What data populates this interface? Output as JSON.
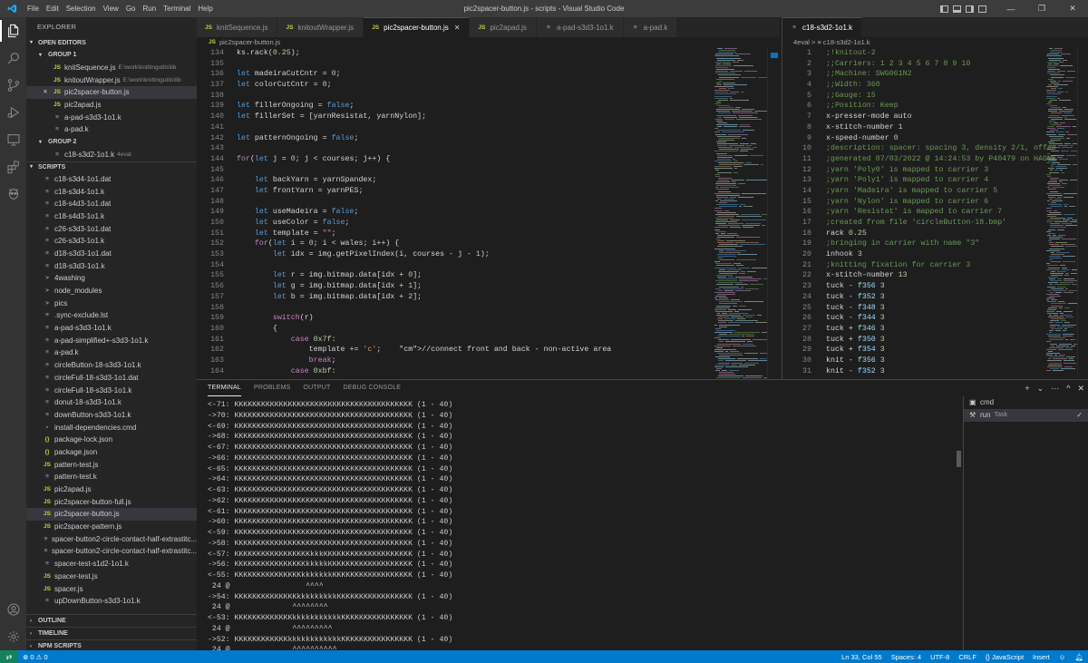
{
  "window": {
    "title": "pic2spacer-button.js - scripts - Visual Studio Code",
    "menu": [
      "File",
      "Edit",
      "Selection",
      "View",
      "Go",
      "Run",
      "Terminal",
      "Help"
    ],
    "controls": [
      "minimize",
      "restore",
      "close"
    ]
  },
  "activity_bar": {
    "icons": [
      "files-icon",
      "search-icon",
      "source-control-icon",
      "run-debug-icon",
      "remote-explorer-icon",
      "extensions-icon",
      "alien-icon"
    ],
    "bottom_icons": [
      "account-icon",
      "settings-gear-icon"
    ]
  },
  "sidebar": {
    "title": "EXPLORER",
    "open_editors_label": "OPEN EDITORS",
    "group1_label": "GROUP 1",
    "group1": [
      {
        "name": "knitSequence.js",
        "desc": "E:\\work\\knittingutils\\lib",
        "icon": "JS"
      },
      {
        "name": "knitoutWrapper.js",
        "desc": "E:\\work\\knittingutils\\lib",
        "icon": "JS"
      },
      {
        "name": "pic2spacer-button.js",
        "desc": "",
        "icon": "JS",
        "close": "✕"
      },
      {
        "name": "pic2apad.js",
        "desc": "",
        "icon": "JS"
      },
      {
        "name": "a-pad-s3d3-1o1.k",
        "desc": "",
        "icon": "≡"
      },
      {
        "name": "a-pad.k",
        "desc": "",
        "icon": "≡"
      }
    ],
    "group2_label": "GROUP 2",
    "group2": [
      {
        "name": "c18-s3d2-1o1.k",
        "desc": "4eval",
        "icon": "≡"
      }
    ],
    "scripts_label": "SCRIPTS",
    "scripts": [
      {
        "name": "c18-s3d4-1o1.dat",
        "icon": "≡"
      },
      {
        "name": "c18-s3d4-1o1.k",
        "icon": "≡"
      },
      {
        "name": "c18-s4d3-1o1.dat",
        "icon": "≡"
      },
      {
        "name": "c18-s4d3-1o1.k",
        "icon": "≡"
      },
      {
        "name": "c26-s3d3-1o1.dat",
        "icon": "≡"
      },
      {
        "name": "c26-s3d3-1o1.k",
        "icon": "≡"
      },
      {
        "name": "d18-s3d3-1o1.dat",
        "icon": "≡"
      },
      {
        "name": "d18-s3d3-1o1.k",
        "icon": "≡"
      },
      {
        "name": "4washing",
        "icon": ">"
      },
      {
        "name": "node_modules",
        "icon": ">"
      },
      {
        "name": "pics",
        "icon": ">"
      },
      {
        "name": ".sync-exclude.lst",
        "icon": "≡"
      },
      {
        "name": "a-pad-s3d3-1o1.k",
        "icon": "≡"
      },
      {
        "name": "a-pad-simplified+-s3d3-1o1.k",
        "icon": "≡"
      },
      {
        "name": "a-pad.k",
        "icon": "≡"
      },
      {
        "name": "circleButton-18-s3d3-1o1.k",
        "icon": "≡"
      },
      {
        "name": "circleFull-18-s3d3-1o1.dat",
        "icon": "≡"
      },
      {
        "name": "circleFull-18-s3d3-1o1.k",
        "icon": "≡"
      },
      {
        "name": "donut-18-s3d3-1o1.k",
        "icon": "≡"
      },
      {
        "name": "downButton-s3d3-1o1.k",
        "icon": "≡"
      },
      {
        "name": "install-dependencies.cmd",
        "icon": "▪"
      },
      {
        "name": "package-lock.json",
        "icon": "{}"
      },
      {
        "name": "package.json",
        "icon": "{}"
      },
      {
        "name": "pattern-test.js",
        "icon": "JS"
      },
      {
        "name": "pattern-test.k",
        "icon": "≡"
      },
      {
        "name": "pic2apad.js",
        "icon": "JS"
      },
      {
        "name": "pic2spacer-button-full.js",
        "icon": "JS"
      },
      {
        "name": "pic2spacer-button.js",
        "icon": "JS"
      },
      {
        "name": "pic2spacer-pattern.js",
        "icon": "JS"
      },
      {
        "name": "spacer-button2-circle-contact-half-extrastitc...",
        "icon": "≡"
      },
      {
        "name": "spacer-button2-circle-contact-half-extrastitc...",
        "icon": "≡"
      },
      {
        "name": "spacer-test-s1d2-1o1.k",
        "icon": "≡"
      },
      {
        "name": "spacer-test.js",
        "icon": "JS"
      },
      {
        "name": "spacer.js",
        "icon": "JS"
      },
      {
        "name": "upDownButton-s3d3-1o1.k",
        "icon": "≡"
      }
    ],
    "outline_label": "OUTLINE",
    "timeline_label": "TIMELINE",
    "npm_label": "NPM SCRIPTS"
  },
  "editor1": {
    "tabs": [
      {
        "label": "knitSequence.js",
        "icon": "JS"
      },
      {
        "label": "knitoutWrapper.js",
        "icon": "JS"
      },
      {
        "label": "pic2spacer-button.js",
        "icon": "JS",
        "close": "✕"
      },
      {
        "label": "pic2apad.js",
        "icon": "JS"
      },
      {
        "label": "a-pad-s3d3-1o1.k",
        "icon": "≡"
      },
      {
        "label": "a-pad.k",
        "icon": "≡"
      }
    ],
    "breadcrumb": "pic2spacer-button.js",
    "lines": [
      {
        "n": "134",
        "t": "ks.rack(0.25);"
      },
      {
        "n": "135",
        "t": ""
      },
      {
        "n": "136",
        "t": "let madeiraCutCntr = 0;"
      },
      {
        "n": "137",
        "t": "let colorCutCntr = 0;"
      },
      {
        "n": "138",
        "t": ""
      },
      {
        "n": "139",
        "t": "let fillerOngoing = false;"
      },
      {
        "n": "140",
        "t": "let fillerSet = [yarnResistat, yarnNylon];"
      },
      {
        "n": "141",
        "t": ""
      },
      {
        "n": "142",
        "t": "let patternOngoing = false;"
      },
      {
        "n": "143",
        "t": ""
      },
      {
        "n": "144",
        "t": "for(let j = 0; j < courses; j++) {"
      },
      {
        "n": "145",
        "t": ""
      },
      {
        "n": "146",
        "t": "    let backYarn = yarnSpandex;"
      },
      {
        "n": "147",
        "t": "    let frontYarn = yarnPES;"
      },
      {
        "n": "148",
        "t": ""
      },
      {
        "n": "149",
        "t": "    let useMadeira = false;"
      },
      {
        "n": "150",
        "t": "    let useColor = false;"
      },
      {
        "n": "151",
        "t": "    let template = \"\";"
      },
      {
        "n": "152",
        "t": "    for(let i = 0; i < wales; i++) {"
      },
      {
        "n": "153",
        "t": "        let idx = img.getPixelIndex(i, courses - j - 1);"
      },
      {
        "n": "154",
        "t": ""
      },
      {
        "n": "155",
        "t": "        let r = img.bitmap.data[idx + 0];"
      },
      {
        "n": "156",
        "t": "        let g = img.bitmap.data[idx + 1];"
      },
      {
        "n": "157",
        "t": "        let b = img.bitmap.data[idx + 2];"
      },
      {
        "n": "158",
        "t": ""
      },
      {
        "n": "159",
        "t": "        switch(r)"
      },
      {
        "n": "160",
        "t": "        {"
      },
      {
        "n": "161",
        "t": "            case 0x7f:"
      },
      {
        "n": "162",
        "t": "                template += 'c';    //connect front and back - non-active area"
      },
      {
        "n": "163",
        "t": "                break;"
      },
      {
        "n": "164",
        "t": "            case 0xbf:"
      }
    ]
  },
  "editor2": {
    "tabs": [
      {
        "label": "c18-s3d2-1o1.k",
        "icon": "≡"
      }
    ],
    "breadcrumb": "4eval  >  ≡  c18-s3d2-1o1.k",
    "lines": [
      {
        "n": "1",
        "t": ";!knitout-2",
        "c": "cm"
      },
      {
        "n": "2",
        "t": ";;Carriers: 1 2 3 4 5 6 7 8 9 10",
        "c": "cm"
      },
      {
        "n": "3",
        "t": ";;Machine: SWG061N2",
        "c": "cm"
      },
      {
        "n": "4",
        "t": ";;Width: 360",
        "c": "cm"
      },
      {
        "n": "5",
        "t": ";;Gauge: 15",
        "c": "cm"
      },
      {
        "n": "6",
        "t": ";;Position: Keep",
        "c": "cm"
      },
      {
        "n": "7",
        "t": "x-presser-mode auto",
        "c": ""
      },
      {
        "n": "8",
        "t": "x-stitch-number 1",
        "c": ""
      },
      {
        "n": "9",
        "t": "x-speed-number 0",
        "c": ""
      },
      {
        "n": "10",
        "t": ";description: spacer: spacing 3, density 2/1, offes",
        "c": "cm"
      },
      {
        "n": "11",
        "t": ";generated 07/03/2022 @ 14:24:53 by P40479 on HAGNE",
        "c": "cm"
      },
      {
        "n": "12",
        "t": ";yarn 'Poly0' is mapped to carrier 3",
        "c": "cm"
      },
      {
        "n": "13",
        "t": ";yarn 'Poly1' is mapped to carrier 4",
        "c": "cm"
      },
      {
        "n": "14",
        "t": ";yarn 'Madeira' is mapped to carrier 5",
        "c": "cm"
      },
      {
        "n": "15",
        "t": ";yarn 'Nylon' is mapped to carrier 6",
        "c": "cm"
      },
      {
        "n": "16",
        "t": ";yarn 'Resistat' is mapped to carrier 7",
        "c": "cm"
      },
      {
        "n": "17",
        "t": ";created from file 'circleButton-18.bmp'",
        "c": "cm"
      },
      {
        "n": "18",
        "t": "rack 0.25",
        "c": ""
      },
      {
        "n": "19",
        "t": ";bringing in carrier with name \"3\"",
        "c": "cm"
      },
      {
        "n": "20",
        "t": "inhook 3",
        "c": ""
      },
      {
        "n": "21",
        "t": ";knitting fixation for carrier 3",
        "c": "cm"
      },
      {
        "n": "22",
        "t": "x-stitch-number 13",
        "c": ""
      },
      {
        "n": "23",
        "t": "tuck - f356 3",
        "c": ""
      },
      {
        "n": "24",
        "t": "tuck - f352 3",
        "c": ""
      },
      {
        "n": "25",
        "t": "tuck - f348 3",
        "c": ""
      },
      {
        "n": "26",
        "t": "tuck - f344 3",
        "c": ""
      },
      {
        "n": "27",
        "t": "tuck + f346 3",
        "c": ""
      },
      {
        "n": "28",
        "t": "tuck + f350 3",
        "c": ""
      },
      {
        "n": "29",
        "t": "tuck + f354 3",
        "c": ""
      },
      {
        "n": "30",
        "t": "knit - f356 3",
        "c": ""
      },
      {
        "n": "31",
        "t": "knit - f352 3",
        "c": ""
      }
    ]
  },
  "panel": {
    "tabs": [
      "TERMINAL",
      "PROBLEMS",
      "OUTPUT",
      "DEBUG CONSOLE"
    ],
    "actions": [
      "+",
      "⌄",
      "⋯",
      "^",
      "✕"
    ],
    "terminal_lines": [
      "<-71: KKKKKKKKKKKKKKKKKKKKKKKKKKKKKKKKKKKKKKKK (1 - 40)",
      "->70: KKKKKKKKKKKKKKKKKKKKKKKKKKKKKKKKKKKKKKKK (1 - 40)",
      "<-69: KKKKKKKKKKKKKKKKKKKKKKKKKKKKKKKKKKKKKKKK (1 - 40)",
      "->68: KKKKKKKKKKKKKKKKKKKKKKKKKKKKKKKKKKKKKKKK (1 - 40)",
      "<-67: KKKKKKKKKKKKKKKKKKKKKKKKKKKKKKKKKKKKKKKK (1 - 40)",
      "->66: KKKKKKKKKKKKKKKKKKKKKKKKKKKKKKKKKKKKKKKK (1 - 40)",
      "<-65: KKKKKKKKKKKKKKKKKKKKKKKKKKKKKKKKKKKKKKKK (1 - 40)",
      "->64: KKKKKKKKKKKKKKKKKKKKKKKKKKKKKKKKKKKKKKKK (1 - 40)",
      "<-63: KKKKKKKKKKKKKKKKKKKKKKKKKKKKKKKKKKKKKKKK (1 - 40)",
      "->62: KKKKKKKKKKKKKKKKKKKKKKKKKKKKKKKKKKKKKKKK (1 - 40)",
      "<-61: KKKKKKKKKKKKKKKKKKKKKKKKKKKKKKKKKKKKKKKK (1 - 40)",
      "->60: KKKKKKKKKKKKKKKKKKKKKKKKKKKKKKKKKKKKKKKK (1 - 40)",
      "<-59: KKKKKKKKKKKKKKKKKKKKKKKKKKKKKKKKKKKKKKKK (1 - 40)",
      "->58: KKKKKKKKKKKKKKKKKKKKKKKKKKKKKKKKKKKKKKKK (1 - 40)",
      "<-57: KKKKKKKKKKKKKKKKKkkkKKKKKKKKKKKKKKKKKKKK (1 - 40)",
      "->56: KKKKKKKKKKKKKKKKkkkkkKKKKKKKKKKKKKKKKKKK (1 - 40)",
      "<-55: KKKKKKKKKKKKKKKkkkkkkkKKKKKKKKKKKKKKKKKK (1 - 40)",
      " 24 @                 ^^^^",
      "->54: KKKKKKKKKKKKKKkkkkkkkkkKKKKKKKKKKKKKKKKK (1 - 40)",
      " 24 @              ^^^^^^^^",
      "<-53: KKKKKKKKKKKKKkkkkkkkkkkkKKKKKKKKKKKKKKKK (1 - 40)",
      " 24 @              ^^^^^^^^^",
      "->52: KKKKKKKKKKKKkkkkkkkkkkkkKKKKKKKKKKKKKKKK (1 - 40)",
      " 24 @              ^^^^^^^^^^",
      "<-51: KKKKKKKKKKKkkkkkkkkkkkkkKKKKKKKKKKKKKKKK (1 - 40)",
      " 24 @              ^^^^^^^^^^^"
    ],
    "terminals": [
      {
        "name": "cmd",
        "sub": ""
      },
      {
        "name": "run",
        "sub": "Task",
        "check": "✓"
      }
    ]
  },
  "status": {
    "errors": "0",
    "warnings": "0",
    "position": "Ln 33, Col 55",
    "spaces": "Spaces: 4",
    "encoding": "UTF-8",
    "eol": "CRLF",
    "language": "JavaScript",
    "mode": "Insert"
  },
  "colors": {
    "accent": "#007acc",
    "activity": "#333333",
    "sidebar": "#252526",
    "editor": "#1e1e1e"
  }
}
